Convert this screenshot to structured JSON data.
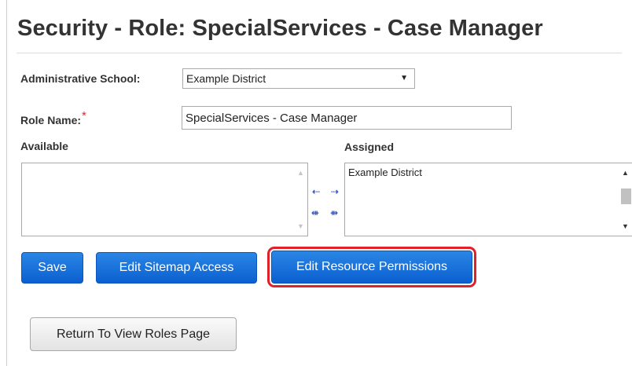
{
  "header": {
    "title": "Security - Role: SpecialServices - Case Manager"
  },
  "form": {
    "admin_school_label": "Administrative School:",
    "admin_school_value": "Example District",
    "role_name_label": "Role Name:",
    "required_marker": "*",
    "role_name_value": "SpecialServices - Case Manager"
  },
  "lists": {
    "available_label": "Available",
    "assigned_label": "Assigned",
    "available_items": [],
    "assigned_items": [
      "Example District"
    ]
  },
  "transfer": {
    "move_left": "⇠",
    "move_right": "⇢",
    "move_all_left": "⇺",
    "move_all_right": "⇻"
  },
  "actions": {
    "save": "Save",
    "edit_sitemap": "Edit Sitemap Access",
    "edit_resource": "Edit Resource Permissions",
    "return": "Return To View Roles Page"
  },
  "colors": {
    "primary": "#0b5fd0",
    "highlight_outline": "#e0202a",
    "required": "#d32f2f"
  }
}
